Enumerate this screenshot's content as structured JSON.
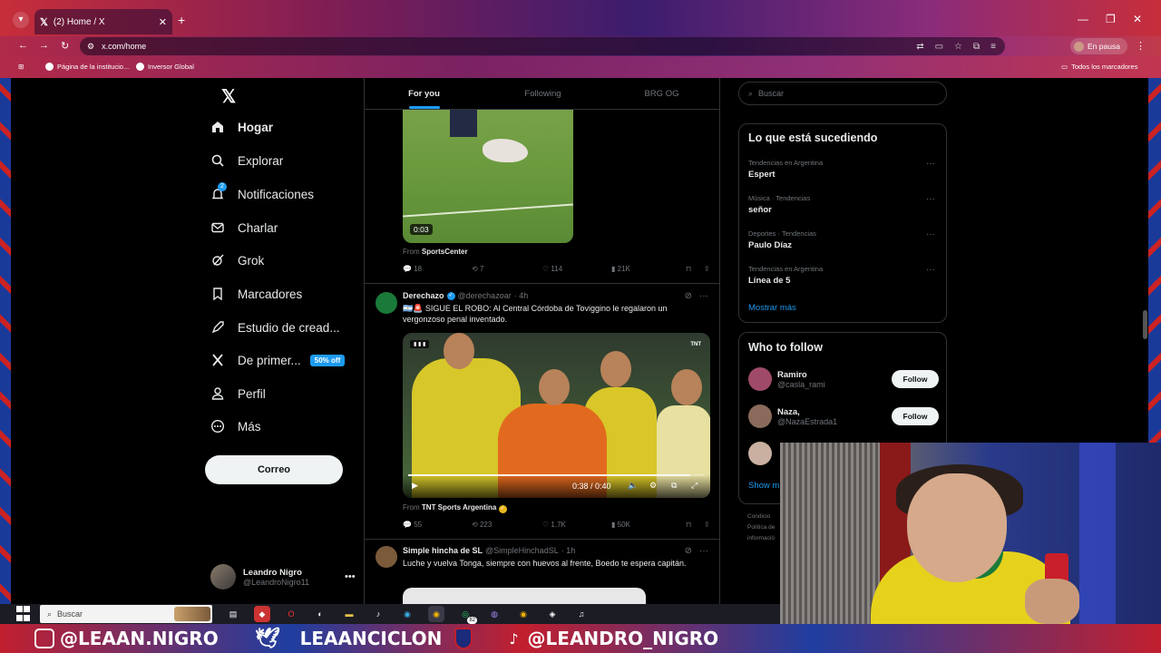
{
  "browser": {
    "tab_title": "(2) Home / X",
    "url": "x.com/home",
    "profile_status": "En pausa",
    "bookmarks": [
      "Página de la institucio...",
      "Inversor Global"
    ],
    "all_bookmarks": "Todos los marcadores"
  },
  "sidebar": {
    "items": [
      {
        "label": "Hogar",
        "icon": "home-icon"
      },
      {
        "label": "Explorar",
        "icon": "search-icon"
      },
      {
        "label": "Notificaciones",
        "icon": "bell-icon",
        "badge": "2"
      },
      {
        "label": "Charlar",
        "icon": "mail-icon"
      },
      {
        "label": "Grok",
        "icon": "grok-icon"
      },
      {
        "label": "Marcadores",
        "icon": "bookmark-icon"
      },
      {
        "label": "Estudio de cread...",
        "icon": "rocket-icon"
      },
      {
        "label": "De primer...",
        "icon": "x-icon",
        "pill": "50% off"
      },
      {
        "label": "Perfil",
        "icon": "person-icon"
      },
      {
        "label": "Más",
        "icon": "more-circle-icon"
      }
    ],
    "post_button": "Correo",
    "account": {
      "name": "Leandro Nigro",
      "handle": "@LeandroNigro11"
    }
  },
  "feed": {
    "tabs": [
      "For you",
      "Following",
      "BRG OG"
    ],
    "tweet1": {
      "video_time": "0:03",
      "from_label": "From",
      "from_source": "SportsCenter",
      "stats": {
        "replies": "18",
        "reposts": "7",
        "likes": "114",
        "views": "21K"
      }
    },
    "tweet2": {
      "author": "Derechazo",
      "handle": "@derechazoar",
      "time": "· 4h",
      "text": "🇦🇷🚨 SIGUE EL ROBO: Al Central Córdoba de Toviggino le regalaron un vergonzoso penal inventado.",
      "video_time": "0:38 / 0:40",
      "video_progress": 0.95,
      "from_label": "From",
      "from_source": "TNT Sports Argentina",
      "stats": {
        "replies": "55",
        "reposts": "223",
        "likes": "1.7K",
        "views": "50K"
      }
    },
    "tweet3": {
      "author": "Simple hincha de SL",
      "handle": "@SimpleHinchadSL",
      "time": "· 1h",
      "text": "Luche y vuelva Tonga, siempre con huevos al frente, Boedo te espera capitán."
    }
  },
  "right": {
    "search_placeholder": "Buscar",
    "trends_title": "Lo que está sucediendo",
    "trends": [
      {
        "meta": "Tendencias en Argentina",
        "name": "Espert"
      },
      {
        "meta": "Música · Tendencias",
        "name": "señor"
      },
      {
        "meta": "Deportes · Tendencias",
        "name": "Paulo Díaz"
      },
      {
        "meta": "Tendencias en Argentina",
        "name": "Línea de 5"
      }
    ],
    "show_more": "Mostrar más",
    "wtf_title": "Who to follow",
    "wtf": [
      {
        "name": "Ramiro",
        "handle": "@casla_rami",
        "button": "Follow"
      },
      {
        "name": "Naza,",
        "handle": "@NazaEstrada1",
        "button": "Follow"
      }
    ],
    "show_more_2": "Show m",
    "footer": [
      "Condicio",
      "Política de",
      "informació"
    ]
  },
  "taskbar": {
    "search_placeholder": "Buscar",
    "whatsapp_badge": "82"
  },
  "overlay": {
    "instagram": "@LEAAN.NIGRO",
    "kick": "LEAANCICLON",
    "tiktok": "@LEANDRO_NIGRO"
  },
  "colors": {
    "accent": "#1d9bf0",
    "background": "#000000",
    "text": "#e7e9ea",
    "muted": "#71767b"
  }
}
